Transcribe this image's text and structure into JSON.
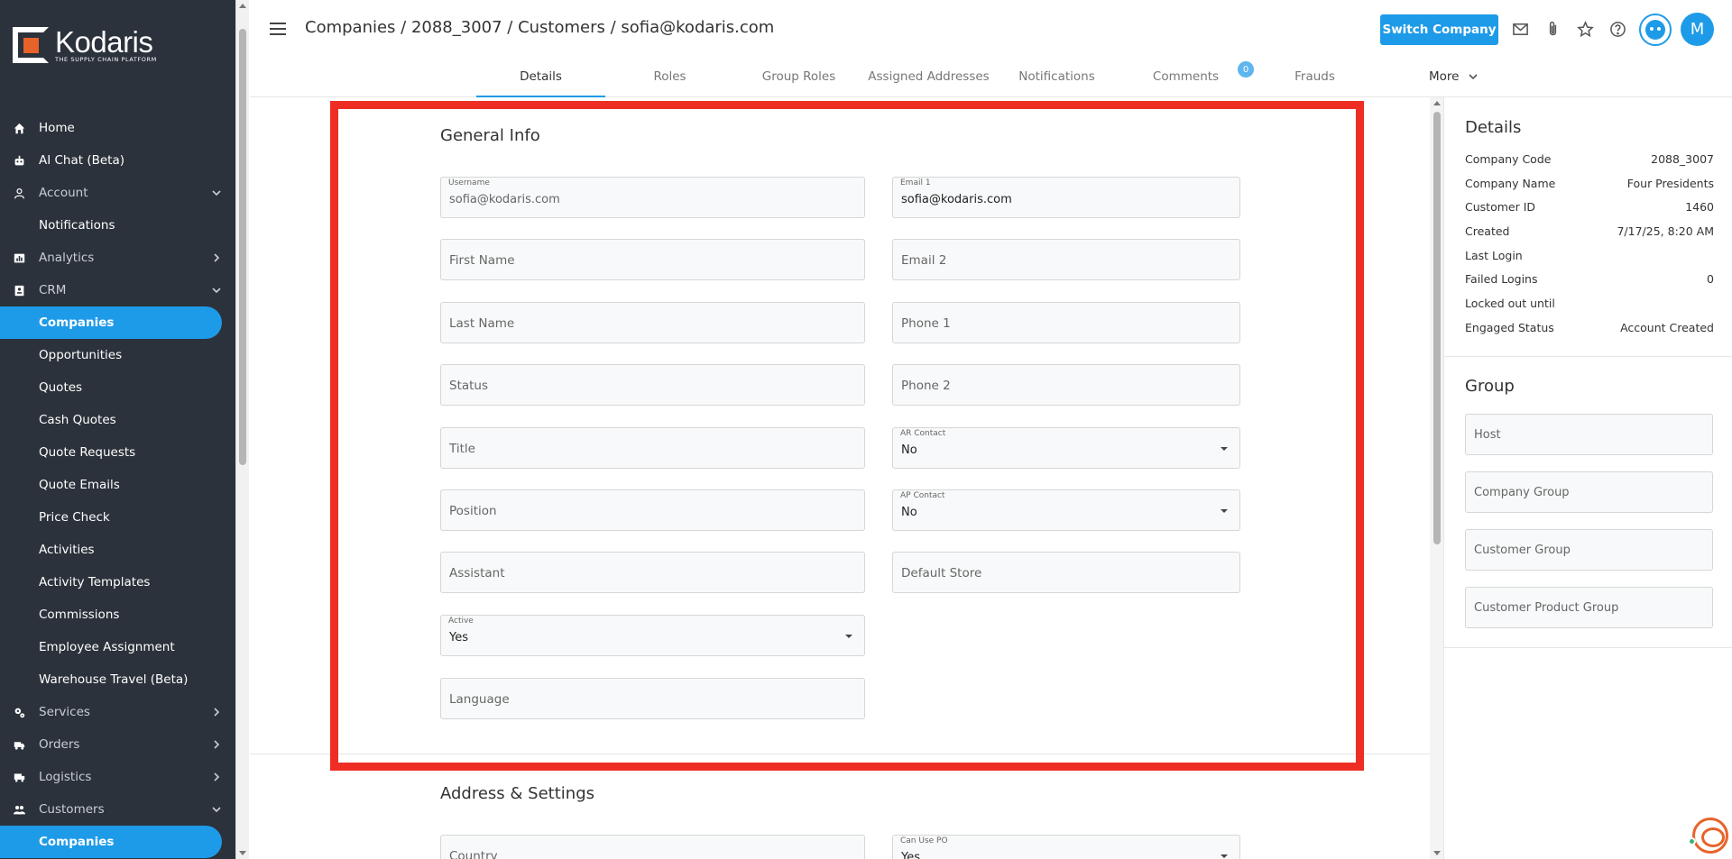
{
  "brand": {
    "name": "Kodaris",
    "tagline": "THE SUPPLY CHAIN PLATFORM",
    "accent": "#1e9be8",
    "logo_color": "#e8632a",
    "highlight_color": "#ee2e24"
  },
  "sidebar": {
    "items": [
      {
        "label": "Home",
        "icon": "home-icon"
      },
      {
        "label": "AI Chat (Beta)",
        "icon": "robot-icon"
      },
      {
        "label": "Account",
        "icon": "user-icon"
      },
      {
        "label": "Notifications"
      },
      {
        "label": "Analytics",
        "icon": "chart-icon"
      },
      {
        "label": "CRM",
        "icon": "contacts-icon"
      },
      {
        "label": "Companies"
      },
      {
        "label": "Opportunities"
      },
      {
        "label": "Quotes"
      },
      {
        "label": "Cash Quotes"
      },
      {
        "label": "Quote Requests"
      },
      {
        "label": "Quote Emails"
      },
      {
        "label": "Price Check"
      },
      {
        "label": "Activities"
      },
      {
        "label": "Activity Templates"
      },
      {
        "label": "Commissions"
      },
      {
        "label": "Employee Assignment"
      },
      {
        "label": "Warehouse Travel (Beta)"
      },
      {
        "label": "Services",
        "icon": "gears-icon"
      },
      {
        "label": "Orders",
        "icon": "truck-icon"
      },
      {
        "label": "Logistics",
        "icon": "shipping-icon"
      },
      {
        "label": "Customers",
        "icon": "people-icon"
      },
      {
        "label": "Companies"
      }
    ]
  },
  "header": {
    "breadcrumb": "Companies / 2088_3007 / Customers / sofia@kodaris.com",
    "switch_company_label": "Switch Company",
    "avatar_initial": "M"
  },
  "tabs": {
    "items": [
      "Details",
      "Roles",
      "Group Roles",
      "Assigned Addresses",
      "Notifications",
      "Comments",
      "Frauds"
    ],
    "comments_badge": "0",
    "more_label": "More"
  },
  "general_info": {
    "title": "General Info",
    "username": {
      "label": "Username",
      "value": "sofia@kodaris.com"
    },
    "email1": {
      "label": "Email 1",
      "value": "sofia@kodaris.com"
    },
    "first_name_ph": "First Name",
    "email2_ph": "Email 2",
    "last_name_ph": "Last Name",
    "phone1_ph": "Phone 1",
    "status_ph": "Status",
    "phone2_ph": "Phone 2",
    "title_ph": "Title",
    "ar_contact": {
      "label": "AR Contact",
      "value": "No"
    },
    "position_ph": "Position",
    "ap_contact": {
      "label": "AP Contact",
      "value": "No"
    },
    "assistant_ph": "Assistant",
    "default_store_ph": "Default Store",
    "active": {
      "label": "Active",
      "value": "Yes"
    },
    "language_ph": "Language"
  },
  "address_settings": {
    "title": "Address & Settings",
    "country_ph": "Country",
    "can_use_po": {
      "label": "Can Use PO",
      "value": "Yes"
    }
  },
  "details_panel": {
    "title": "Details",
    "rows": [
      {
        "k": "Company Code",
        "v": "2088_3007"
      },
      {
        "k": "Company Name",
        "v": "Four Presidents"
      },
      {
        "k": "Customer ID",
        "v": "1460"
      },
      {
        "k": "Created",
        "v": "7/17/25, 8:20 AM"
      },
      {
        "k": "Last Login",
        "v": ""
      },
      {
        "k": "Failed Logins",
        "v": "0"
      },
      {
        "k": "Locked out until",
        "v": ""
      },
      {
        "k": "Engaged Status",
        "v": "Account Created"
      }
    ]
  },
  "group_panel": {
    "title": "Group",
    "fields": [
      "Host",
      "Company Group",
      "Customer Group",
      "Customer Product Group"
    ]
  }
}
